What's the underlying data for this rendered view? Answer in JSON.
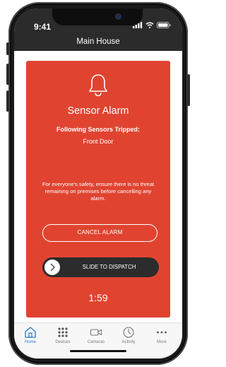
{
  "status_bar": {
    "time": "9:41",
    "icons": [
      "signal-icon",
      "wifi-icon",
      "battery-icon"
    ]
  },
  "header": {
    "title": "Main House"
  },
  "alarm": {
    "icon": "bell-icon",
    "title": "Sensor Alarm",
    "tripped_label": "Following Sensors Tripped:",
    "tripped_sensor": "Front Door",
    "notice": "For everyone's safety, ensure there is no threat remaining on premises before cancelling any alarm.",
    "cancel_label": "CANCEL ALARM",
    "slide_label": "SLIDE TO DISPATCH",
    "countdown": "1:59"
  },
  "tabs": [
    {
      "label": "Home",
      "icon": "home-icon",
      "active": true
    },
    {
      "label": "Devices",
      "icon": "devices-grid-icon",
      "active": false
    },
    {
      "label": "Cameras",
      "icon": "camera-icon",
      "active": false
    },
    {
      "label": "Activity",
      "icon": "clock-icon",
      "active": false
    },
    {
      "label": "More",
      "icon": "more-icon",
      "active": false
    }
  ],
  "colors": {
    "alarm_red": "#e04431",
    "header_dark": "#2b2b2b",
    "active_tab": "#2a78c9",
    "inactive_tab": "#7a7a7a"
  }
}
